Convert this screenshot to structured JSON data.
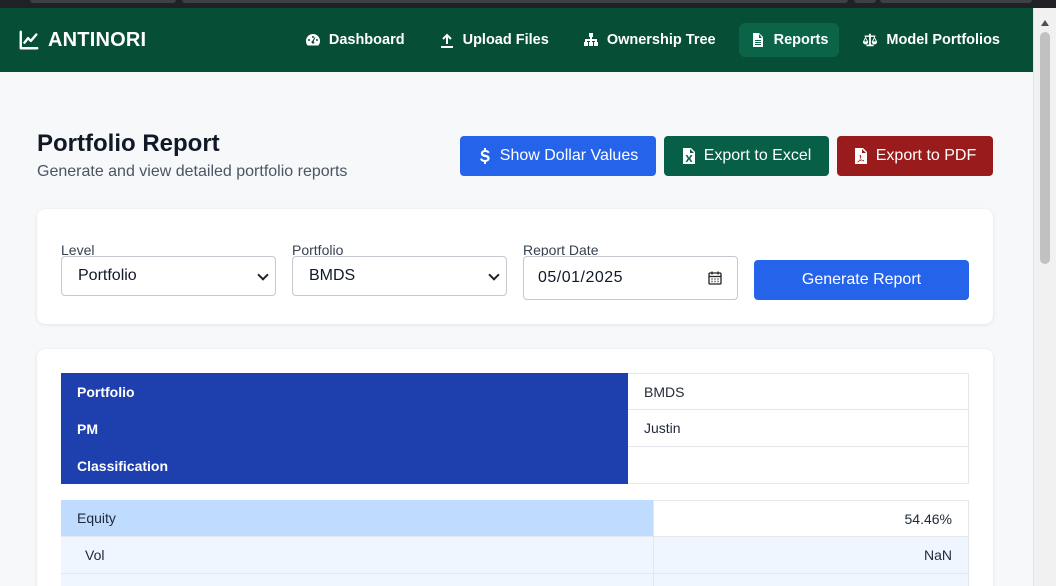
{
  "navbar": {
    "brand": "ANTINORI",
    "items": [
      {
        "label": "Dashboard",
        "icon": "gauge-icon",
        "active": false
      },
      {
        "label": "Upload Files",
        "icon": "upload-icon",
        "active": false
      },
      {
        "label": "Ownership Tree",
        "icon": "sitemap-icon",
        "active": false
      },
      {
        "label": "Reports",
        "icon": "file-icon",
        "active": true
      },
      {
        "label": "Model Portfolios",
        "icon": "scale-icon",
        "active": false
      }
    ]
  },
  "header": {
    "title": "Portfolio Report",
    "subtitle": "Generate and view detailed portfolio reports",
    "show_dollar_label": "Show Dollar Values",
    "export_excel_label": "Export to Excel",
    "export_pdf_label": "Export to PDF"
  },
  "filters": {
    "level_label": "Level",
    "level_value": "Portfolio",
    "portfolio_label": "Portfolio",
    "portfolio_value": "BMDS",
    "date_label": "Report Date",
    "date_value": "05/01/2025",
    "generate_label": "Generate Report"
  },
  "report": {
    "info": [
      {
        "key": "Portfolio",
        "value": "BMDS"
      },
      {
        "key": "PM",
        "value": "Justin"
      },
      {
        "key": "Classification",
        "value": ""
      }
    ],
    "allocations": [
      {
        "key": "Equity",
        "value": "54.46%",
        "level": 1
      },
      {
        "key": "Vol",
        "value": "NaN",
        "level": 2
      },
      {
        "key": "",
        "value": "",
        "level": 3
      }
    ]
  },
  "colors": {
    "navbar": "#064e35",
    "primary": "#2563eb",
    "excel": "#065f46",
    "pdf": "#991b1b",
    "info_header": "#1e40af",
    "equity_row": "#bfdbfe"
  }
}
